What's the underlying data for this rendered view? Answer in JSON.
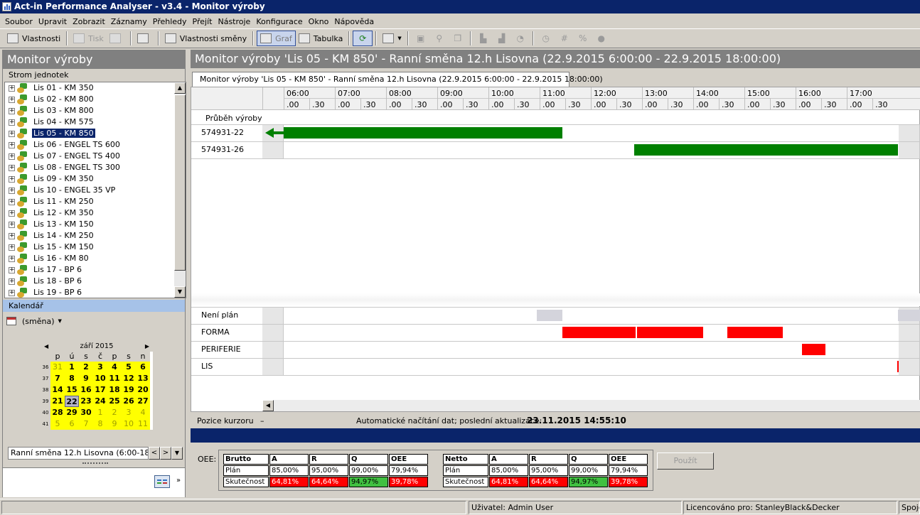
{
  "window": {
    "title": "Act-in Performance Analyser - v3.4 - Monitor výroby"
  },
  "menu": [
    "Soubor",
    "Upravit",
    "Zobrazit",
    "Záznamy",
    "Přehledy",
    "Přejít",
    "Nástroje",
    "Konfigurace",
    "Okno",
    "Nápověda"
  ],
  "toolbar": {
    "properties": "Vlastnosti",
    "print": "Tisk",
    "shift_properties": "Vlastnosti směny",
    "graph": "Graf",
    "table": "Tabulka",
    "hash": "#",
    "percent": "%"
  },
  "left": {
    "title": "Monitor výroby",
    "tree_header": "Strom jednotek",
    "tree_items": [
      "Lis 01 - KM 350",
      "Lis 02 - KM 800",
      "Lis 03 - KM 800",
      "Lis 04 - KM 575",
      "Lis 05 - KM 850",
      "Lis 06 - ENGEL TS 600",
      "Lis 07 - ENGEL TS 400",
      "Lis 08 - ENGEL TS 300",
      "Lis 09 - KM 350",
      "Lis 10 - ENGEL 35 VP",
      "Lis 11 - KM 250",
      "Lis 12 - KM 350",
      "Lis 13 - KM 150",
      "Lis 14 - KM 250",
      "Lis 15 - KM 150",
      "Lis 16 - KM 80",
      "Lis 17 - BP 6",
      "Lis 18 - BP 6",
      "Lis 19 - BP 6"
    ],
    "selected_index": 4,
    "calendar_header": "Kalendář",
    "calendar_mode": "(směna)",
    "calendar": {
      "month": "září 2015",
      "day_headers": [
        "p",
        "ú",
        "s",
        "č",
        "p",
        "s",
        "n"
      ],
      "weeks": [
        {
          "num": "36",
          "days": [
            "31",
            "1",
            "2",
            "3",
            "4",
            "5",
            "6"
          ],
          "other": [
            0
          ]
        },
        {
          "num": "37",
          "days": [
            "7",
            "8",
            "9",
            "10",
            "11",
            "12",
            "13"
          ],
          "other": []
        },
        {
          "num": "38",
          "days": [
            "14",
            "15",
            "16",
            "17",
            "18",
            "19",
            "20"
          ],
          "other": []
        },
        {
          "num": "39",
          "days": [
            "21",
            "22",
            "23",
            "24",
            "25",
            "26",
            "27"
          ],
          "other": []
        },
        {
          "num": "40",
          "days": [
            "28",
            "29",
            "30",
            "1",
            "2",
            "3",
            "4"
          ],
          "other": [
            3,
            4,
            5,
            6
          ]
        },
        {
          "num": "41",
          "days": [
            "5",
            "6",
            "7",
            "8",
            "9",
            "10",
            "11"
          ],
          "other": [
            0,
            1,
            2,
            3,
            4,
            5,
            6
          ]
        }
      ],
      "today": "22"
    },
    "shift_value": "Ranní směna 12.h Lisovna (6:00-18:0"
  },
  "right": {
    "title": "Monitor výroby 'Lis 05 - KM 850' - Ranní směna 12.h Lisovna (22.9.2015 6:00:00 - 22.9.2015 18:00:00)",
    "tab": "Monitor výroby 'Lis 05 - KM 850' - Ranní směna 12.h Lisovna (22.9.2015 6:00:00 - 22.9.2015 18:00:00)",
    "hours": [
      "06:00",
      "07:00",
      "08:00",
      "09:00",
      "10:00",
      "11:00",
      "12:00",
      "13:00",
      "14:00",
      "15:00",
      "16:00",
      "17:00"
    ],
    "half_labels": [
      ".00",
      ".30"
    ],
    "section_label": "Průběh výroby",
    "production_rows": [
      {
        "label": "574931-22",
        "bars": [
          {
            "start": 6.0,
            "end": 11.45
          }
        ],
        "arrow": true
      },
      {
        "label": "574931-26",
        "bars": [
          {
            "start": 12.85,
            "end": 18.0
          }
        ],
        "arrow": false
      }
    ],
    "status_rows": [
      {
        "label": "Není plán",
        "color": "#d4d4dc",
        "bars": [
          {
            "start": 10.95,
            "end": 11.45
          },
          {
            "start": 18.0,
            "end": 18.8
          }
        ]
      },
      {
        "label": "FORMA",
        "color": "#ff0000",
        "bars": [
          {
            "start": 11.45,
            "end": 12.87
          },
          {
            "start": 12.9,
            "end": 14.2
          },
          {
            "start": 14.67,
            "end": 15.75
          }
        ]
      },
      {
        "label": "PERIFERIE",
        "color": "#ff0000",
        "bars": [
          {
            "start": 16.13,
            "end": 16.58
          }
        ]
      },
      {
        "label": "LIS",
        "color": "#ff0000",
        "bars": [
          {
            "start": 17.98,
            "end": 18.0
          }
        ]
      }
    ],
    "cursor_label": "Pozice kurzoru",
    "cursor_value": "–",
    "auto_load": "Automatické načítání dat; poslední aktualizace:",
    "last_update": "23.11.2015 14:55:10"
  },
  "oee": {
    "label": "OEE:",
    "brutto": {
      "header": [
        "Brutto",
        "A",
        "R",
        "Q",
        "OEE"
      ],
      "plan": [
        "Plán",
        "85,00%",
        "95,00%",
        "99,00%",
        "79,94%"
      ],
      "actual": [
        "Skutečnost",
        "64,81%",
        "64,64%",
        "94,97%",
        "39,78%"
      ]
    },
    "netto": {
      "header": [
        "Netto",
        "A",
        "R",
        "Q",
        "OEE"
      ],
      "plan": [
        "Plán",
        "85,00%",
        "95,00%",
        "99,00%",
        "79,94%"
      ],
      "actual": [
        "Skutečnost",
        "64,81%",
        "64,64%",
        "94,97%",
        "39,78%"
      ]
    },
    "actual_colors": [
      "",
      "red",
      "red",
      "green",
      "red"
    ],
    "apply": "Použít"
  },
  "statusbar": {
    "user": "Uživatel: Admin User",
    "license": "Licencováno pro: StanleyBlack&Decker",
    "connection": "Spojeno"
  }
}
